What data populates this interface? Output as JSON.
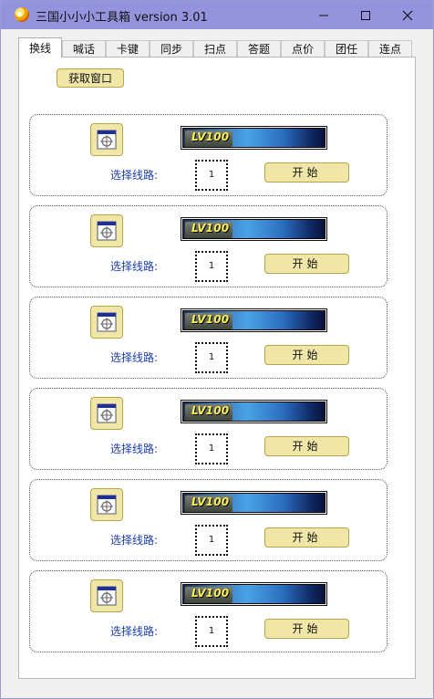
{
  "window": {
    "title": "三国小小小工具箱 version 3.01"
  },
  "tabs": [
    {
      "label": "换线",
      "active": true
    },
    {
      "label": "喊话",
      "active": false
    },
    {
      "label": "卡键",
      "active": false
    },
    {
      "label": "同步",
      "active": false
    },
    {
      "label": "扫点",
      "active": false
    },
    {
      "label": "答题",
      "active": false
    },
    {
      "label": "点价",
      "active": false
    },
    {
      "label": "团任",
      "active": false
    },
    {
      "label": "连点",
      "active": false
    }
  ],
  "panel": {
    "get_window_label": "获取窗口",
    "slots": [
      {
        "level_text": "LV100",
        "route_label": "选择线路:",
        "route_value": "1",
        "start_label": "开始"
      },
      {
        "level_text": "LV100",
        "route_label": "选择线路:",
        "route_value": "1",
        "start_label": "开始"
      },
      {
        "level_text": "LV100",
        "route_label": "选择线路:",
        "route_value": "1",
        "start_label": "开始"
      },
      {
        "level_text": "LV100",
        "route_label": "选择线路:",
        "route_value": "1",
        "start_label": "开始"
      },
      {
        "level_text": "LV100",
        "route_label": "选择线路:",
        "route_value": "1",
        "start_label": "开始"
      },
      {
        "level_text": "LV100",
        "route_label": "选择线路:",
        "route_value": "1",
        "start_label": "开始"
      }
    ]
  },
  "colors": {
    "titlebar": "#9494de",
    "button_fill": "#efe6a8",
    "button_border": "#b5a546",
    "label_blue": "#1a3db0",
    "level_text": "#f7ef57"
  },
  "icons": {
    "app": "app-icon",
    "minimize": "minimize-icon",
    "maximize": "maximize-icon",
    "close": "close-icon",
    "target": "crosshair-window-icon"
  }
}
